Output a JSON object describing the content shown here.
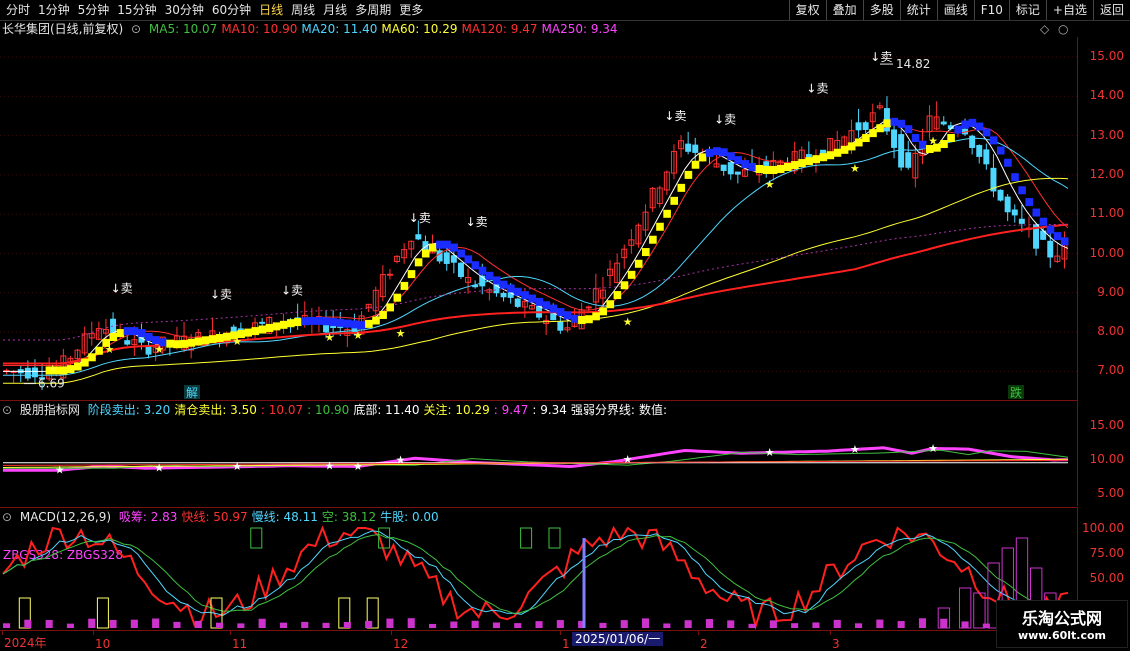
{
  "topbar": {
    "periods": [
      "分时",
      "1分钟",
      "5分钟",
      "15分钟",
      "30分钟",
      "60分钟",
      "日线",
      "周线",
      "月线",
      "多周期",
      "更多"
    ],
    "active": "日线",
    "right_buttons": [
      "复权",
      "叠加",
      "多股",
      "统计",
      "画线",
      "F10",
      "标记",
      "+自选",
      "返回"
    ]
  },
  "main_legend": {
    "title": "长华集团(日线,前复权)",
    "items": [
      {
        "label": "MA5: 10.07",
        "color": "#3fbf3f"
      },
      {
        "label": "MA10: 10.90",
        "color": "#ff3030"
      },
      {
        "label": "MA20: 11.40",
        "color": "#4fd6ff"
      },
      {
        "label": "MA60: 10.29",
        "color": "#ffff33"
      },
      {
        "label": "MA120: 9.47",
        "color": "#ff3030"
      },
      {
        "label": "MA250: 9.34",
        "color": "#ff44ff"
      }
    ]
  },
  "price_axis": [
    "15.00",
    "14.00",
    "13.00",
    "12.00",
    "11.00",
    "10.00",
    "9.00",
    "8.00",
    "7.00"
  ],
  "annotations": {
    "high": "14.82",
    "low": "6.69",
    "sell": "卖",
    "jie": "解",
    "die": "跌"
  },
  "indicator_legend": {
    "title": "股朋指标网",
    "items": [
      {
        "label": "阶段卖出: 3.20",
        "color": "#4fd6ff"
      },
      {
        "label": "清仓卖出: 3.50",
        "color": "#ffff33"
      },
      {
        "label": ": 10.07",
        "color": "#ff3030"
      },
      {
        "label": ": 10.90",
        "color": "#3fbf3f"
      },
      {
        "label": "底部: 11.40",
        "color": "#ffffff"
      },
      {
        "label": "关注: 10.29",
        "color": "#ffff33"
      },
      {
        "label": ": 9.47",
        "color": "#ff44ff"
      },
      {
        "label": ": 9.34",
        "color": "#ffffff"
      },
      {
        "label": "强弱分界线:",
        "color": "#ffffff"
      },
      {
        "label": "数值:",
        "color": "#ffffff"
      }
    ]
  },
  "indicator_axis": [
    "15.00",
    "10.00",
    "5.00"
  ],
  "macd_legend": {
    "title": "MACD(12,26,9)",
    "items": [
      {
        "label": "吸筹: 2.83",
        "color": "#ff44ff"
      },
      {
        "label": "快线: 50.97",
        "color": "#ff3030"
      },
      {
        "label": "慢线: 48.11",
        "color": "#4fd6ff"
      },
      {
        "label": "空: 38.12",
        "color": "#3fbf3f"
      },
      {
        "label": "牛股: 0.00",
        "color": "#4fd6ff"
      }
    ],
    "sublabel": "ZBGS328: ZBGS328"
  },
  "macd_axis": [
    "100.00",
    "75.00",
    "50.00"
  ],
  "x_axis": {
    "labels": [
      "2024年",
      "10",
      "11",
      "12",
      "1",
      "2",
      "3"
    ],
    "cursor_date": "2025/01/06/一"
  },
  "watermark": {
    "line1": "乐淘公式网",
    "line2": "www.60lt.com"
  },
  "colors": {
    "up": "#ff3030",
    "down": "#4fd6ff",
    "axis": "#7a1010",
    "yellow": "#ffff00",
    "blue": "#1a2cff"
  }
}
